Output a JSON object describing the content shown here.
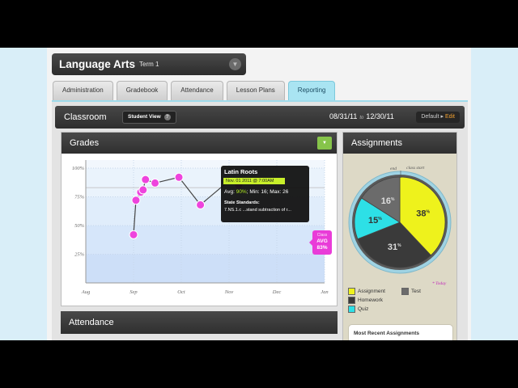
{
  "course": {
    "title": "Language Arts",
    "term": "Term 1"
  },
  "tabs": [
    "Administration",
    "Gradebook",
    "Attendance",
    "Lesson Plans",
    "Reporting"
  ],
  "header": {
    "section": "Classroom",
    "student_view": "Student View",
    "date_from": "08/31/11",
    "date_to_word": "to",
    "date_to": "12/30/11",
    "default_label": "Default",
    "edit_label": "Edit"
  },
  "grades_panel": {
    "title": "Grades"
  },
  "attendance_panel": {
    "title": "Attendance"
  },
  "assignments_panel": {
    "title": "Assignments",
    "end_label": "end",
    "start_label": "class start",
    "today_label": "* Today",
    "legend": [
      "Assignment",
      "Test",
      "Homework",
      "Quiz"
    ],
    "recent_label": "Most Recent Assignments"
  },
  "tooltip": {
    "title": "Latin Roots",
    "date": "Nov. 01 2011 @ 7:00AM",
    "avg_label": "Avg:",
    "avg_value": "90%",
    "minmax": "; Min: 16; Max: 26",
    "standards_label": "State Standards:",
    "standard": "7.NS.1.c ...stand subtraction of r..."
  },
  "avg_badge": {
    "class_label": "Class",
    "label": "AVG",
    "value": "83%"
  },
  "colors": {
    "assignment": "#eef21c",
    "homework": "#3a3a3a",
    "test": "#6b6b6b",
    "quiz": "#2de0e6",
    "points": "#ee44dd",
    "tab_active": "#a9e4f2"
  },
  "chart_data": [
    {
      "type": "line",
      "title": "Grades",
      "x_categories": [
        "Aug",
        "Sep",
        "Oct",
        "Nov",
        "Dec",
        "Jan"
      ],
      "y_ticks": [
        "100%",
        "75%",
        "50%",
        "25%"
      ],
      "ylim": [
        0,
        100
      ],
      "class_avg": 83,
      "series": [
        {
          "points": [
            {
              "x": 1.0,
              "y": 42
            },
            {
              "x": 1.05,
              "y": 72
            },
            {
              "x": 1.15,
              "y": 79
            },
            {
              "x": 1.2,
              "y": 81
            },
            {
              "x": 1.25,
              "y": 90
            },
            {
              "x": 1.45,
              "y": 87
            },
            {
              "x": 1.95,
              "y": 92
            },
            {
              "x": 2.4,
              "y": 68
            },
            {
              "x": 3.0,
              "y": 89
            },
            {
              "x": 3.2,
              "y": 85
            }
          ]
        }
      ]
    },
    {
      "type": "pie",
      "title": "Assignments",
      "slices": [
        {
          "label": "Assignment",
          "value": 38
        },
        {
          "label": "Homework",
          "value": 31
        },
        {
          "label": "Quiz",
          "value": 15
        },
        {
          "label": "Test",
          "value": 16
        }
      ]
    }
  ]
}
